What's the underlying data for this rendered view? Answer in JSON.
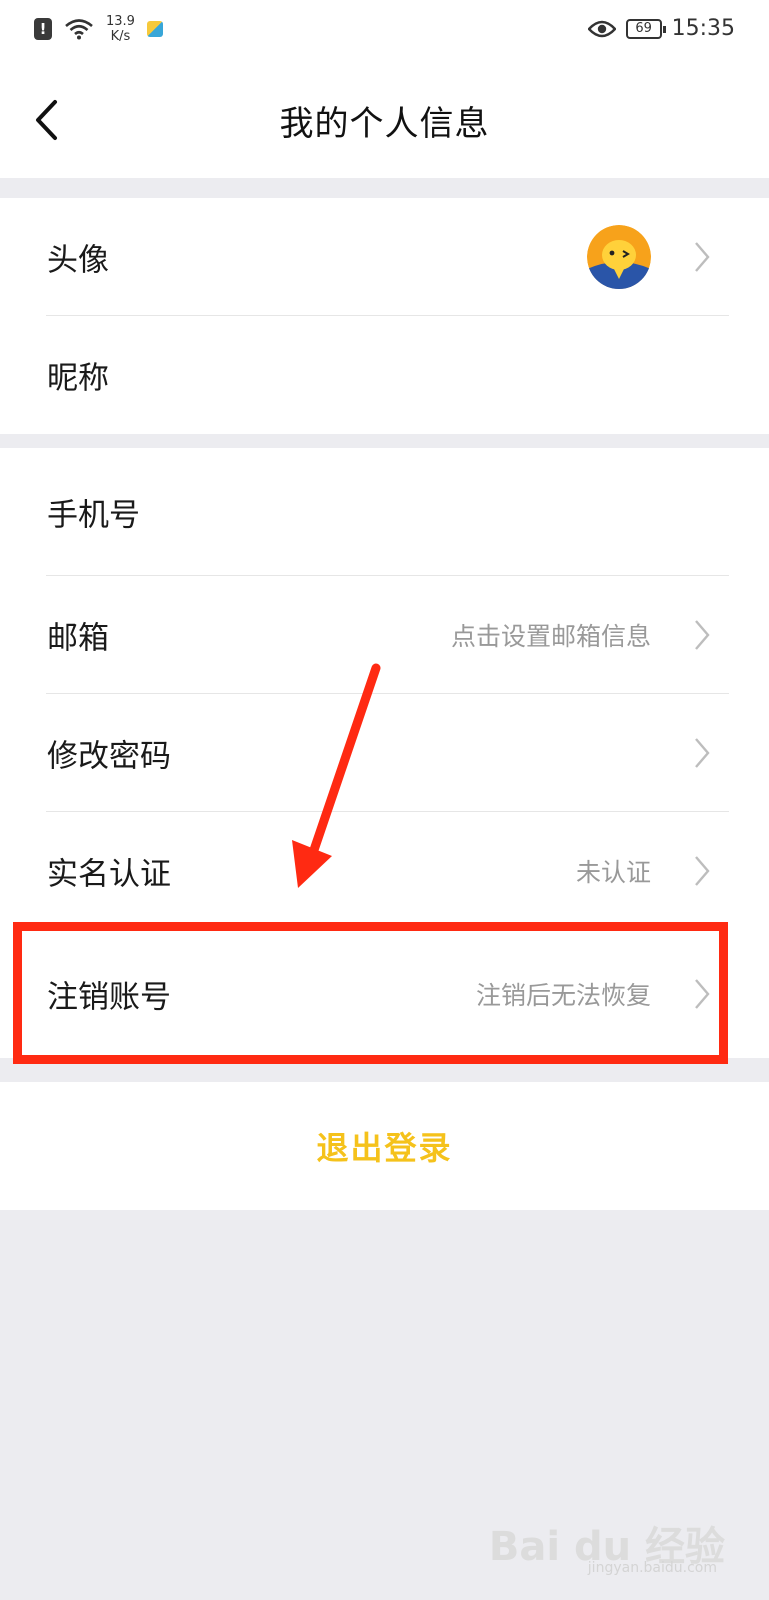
{
  "status_bar": {
    "net_speed_value": "13.9",
    "net_speed_unit": "K/s",
    "battery": "69",
    "time": "15:35",
    "icons": [
      "alert-icon",
      "wifi-icon",
      "app-icon",
      "eye-icon",
      "battery-icon"
    ]
  },
  "nav": {
    "title": "我的个人信息",
    "back_icon": "chevron-left-icon"
  },
  "section1": {
    "rows": [
      {
        "label": "头像",
        "value": "",
        "has_chevron": true
      },
      {
        "label": "昵称",
        "value": "",
        "has_chevron": false
      }
    ]
  },
  "section2": {
    "rows": [
      {
        "label": "手机号",
        "value": "",
        "has_chevron": false
      },
      {
        "label": "邮箱",
        "value": "点击设置邮箱信息",
        "has_chevron": true
      },
      {
        "label": "修改密码",
        "value": "",
        "has_chevron": true
      },
      {
        "label": "实名认证",
        "value": "未认证",
        "has_chevron": true
      },
      {
        "label": "注销账号",
        "value": "注销后无法恢复",
        "has_chevron": true
      }
    ]
  },
  "logout": {
    "label": "退出登录"
  },
  "colors": {
    "accent": "#f5c21b",
    "highlight": "#ff2a12",
    "background": "#ececf0"
  },
  "watermark": {
    "brand": "Bai du 经验",
    "url": "jingyan.baidu.com"
  }
}
